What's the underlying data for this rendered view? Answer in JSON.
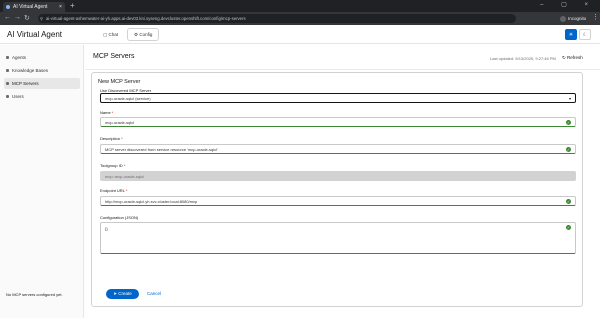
{
  "browser": {
    "tab_title": "AI Virtual Agent",
    "tab_close": "×",
    "new_tab": "+",
    "window_controls": "– ▢ ×",
    "url": "ai-virtual-agent-ashemwater-ai-yh.apps.ai-dev03.kni.syseng.devcluster.openshift.com/config/mcp-servers",
    "profile": "Incognito",
    "menu": "⋮"
  },
  "app": {
    "title": "AI Virtual Agent",
    "tabs": [
      {
        "label": "Chat"
      },
      {
        "label": "Config"
      }
    ],
    "theme": {
      "light_icon": "☀",
      "dark_icon": "☾"
    }
  },
  "sidebar": {
    "items": [
      {
        "label": "Agents"
      },
      {
        "label": "Knowledge Bases"
      },
      {
        "label": "MCP Servers"
      },
      {
        "label": "Users"
      }
    ]
  },
  "page": {
    "title": "MCP Servers",
    "last_updated": "Last updated: 5/13/2025, 9:27:46 PM",
    "refresh_label": "Refresh",
    "empty_text": "No MCP servers configured yet."
  },
  "form": {
    "title": "New MCP Server",
    "discovered": {
      "label": "Use Discovered MCP Server",
      "value": "mcp-oracle-sqlcl (service)"
    },
    "name": {
      "label": "Name",
      "value": "mcp-oracle-sqlcl"
    },
    "description": {
      "label": "Description",
      "value": "MCP server discovered from service resource 'mcp-oracle-sqlcl'"
    },
    "toolgroup": {
      "label": "Toolgroup ID",
      "value": "mcp::mcp-oracle-sqlcl"
    },
    "endpoint": {
      "label": "Endpoint URL",
      "value": "http://mcp-oracle-sqlcl.yh.svc.cluster.local:8080/mcp"
    },
    "config": {
      "label": "Configuration (JSON)",
      "value": "{}"
    },
    "create_label": "Create",
    "cancel_label": "Cancel"
  },
  "colors": {
    "primary": "#0066cc",
    "success": "#3e8635",
    "danger": "#c9190b"
  }
}
